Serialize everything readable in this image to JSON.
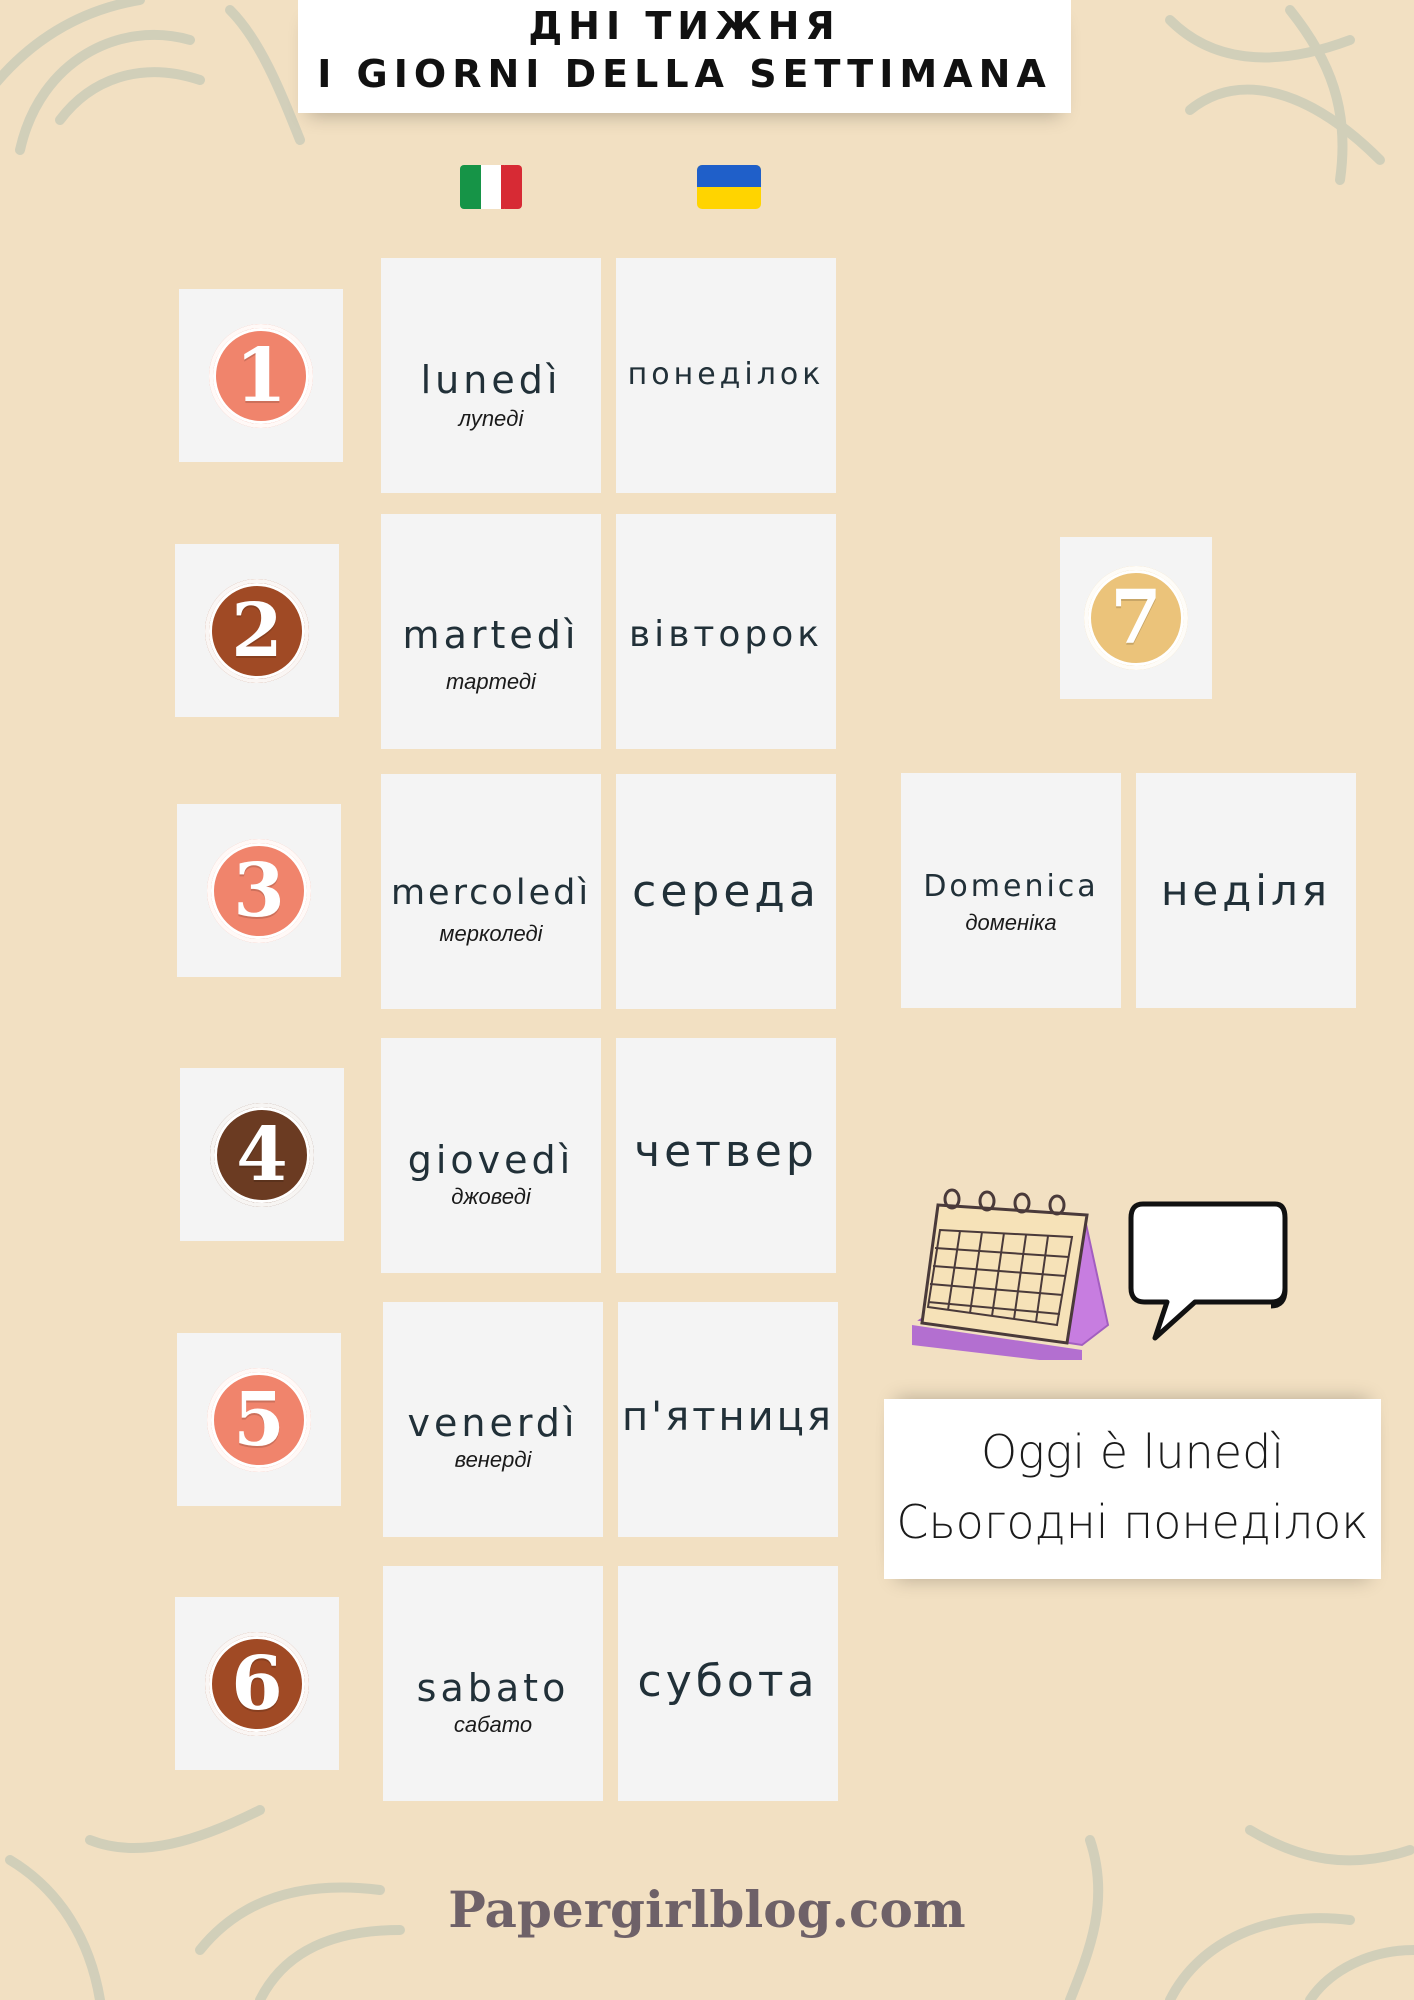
{
  "header": {
    "title_uk": "ДНІ ТИЖНЯ",
    "title_it": "I GIORNI DELLA SETTIMANA"
  },
  "flags": {
    "italy_icon": "italy-flag-icon",
    "ukraine_icon": "ukraine-flag-icon",
    "italy_colors": [
      "#169447",
      "#ffffff",
      "#d72a34"
    ],
    "ukraine_colors": [
      "#1f5fc9",
      "#ffd400"
    ]
  },
  "days": [
    {
      "number": "1",
      "italian": "lunedì",
      "translit": "луneді",
      "ukrainian": "понеділок",
      "color": "#f0846c"
    },
    {
      "number": "2",
      "italian": "martedì",
      "translit": "тартеді",
      "ukrainian": "вівторок",
      "color": "#a04a25"
    },
    {
      "number": "3",
      "italian": "mercoledì",
      "translit": "мерколеді",
      "ukrainian": "середа",
      "color": "#f0846c"
    },
    {
      "number": "4",
      "italian": "giovedì",
      "translit": "джоведі",
      "ukrainian": "четвер",
      "color": "#6b3b22"
    },
    {
      "number": "5",
      "italian": "venerdì",
      "translit": "венерді",
      "ukrainian": "п'ятниця",
      "color": "#f0846c"
    },
    {
      "number": "6",
      "italian": "sabato",
      "translit": "сабато",
      "ukrainian": "субота",
      "color": "#a04a25"
    },
    {
      "number": "7",
      "italian": "Domenica",
      "translit": "доменіка",
      "ukrainian": "неділя",
      "color": "#ebc37a"
    }
  ],
  "illustration": {
    "calendar_icon": "calendar-icon",
    "speech_bubble_icon": "speech-bubble-icon"
  },
  "example": {
    "italian": "Oggi è lunedì",
    "ukrainian": "Сьогодні понеділок"
  },
  "footer": {
    "site": "Papergirlblog.com"
  }
}
